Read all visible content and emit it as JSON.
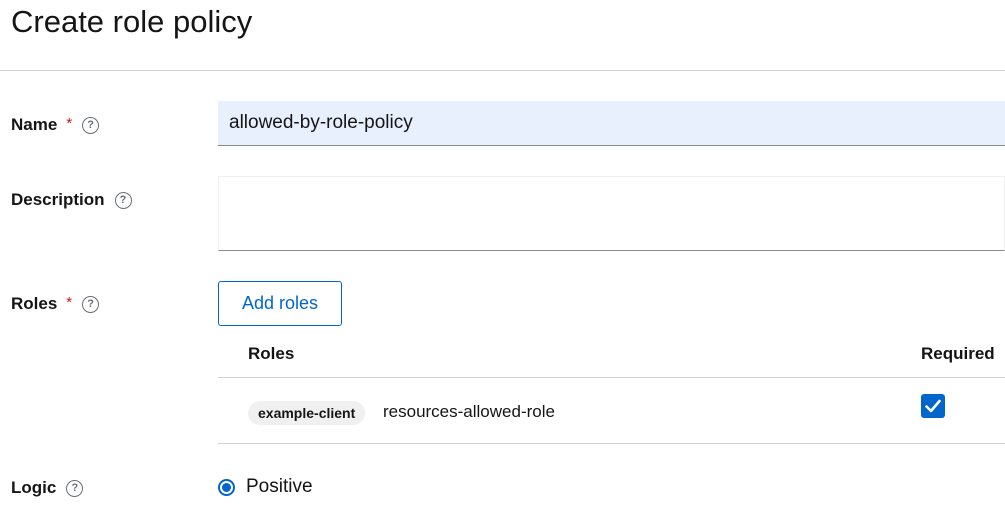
{
  "page": {
    "title": "Create role policy"
  },
  "form": {
    "name": {
      "label": "Name",
      "required_mark": "*",
      "value": "allowed-by-role-policy"
    },
    "description": {
      "label": "Description",
      "value": ""
    },
    "roles": {
      "label": "Roles",
      "required_mark": "*",
      "add_button": "Add roles",
      "columns": [
        "Roles",
        "Required"
      ],
      "rows": [
        {
          "client": "example-client",
          "role": "resources-allowed-role",
          "required": true
        }
      ]
    },
    "logic": {
      "label": "Logic",
      "option": "Positive",
      "selected": true
    }
  },
  "colors": {
    "accent": "#0066cc",
    "required": "#c9190b",
    "autofill": "#e8f0fe"
  },
  "icons": {
    "help": "question-circle-icon",
    "check": "checkmark-icon"
  }
}
